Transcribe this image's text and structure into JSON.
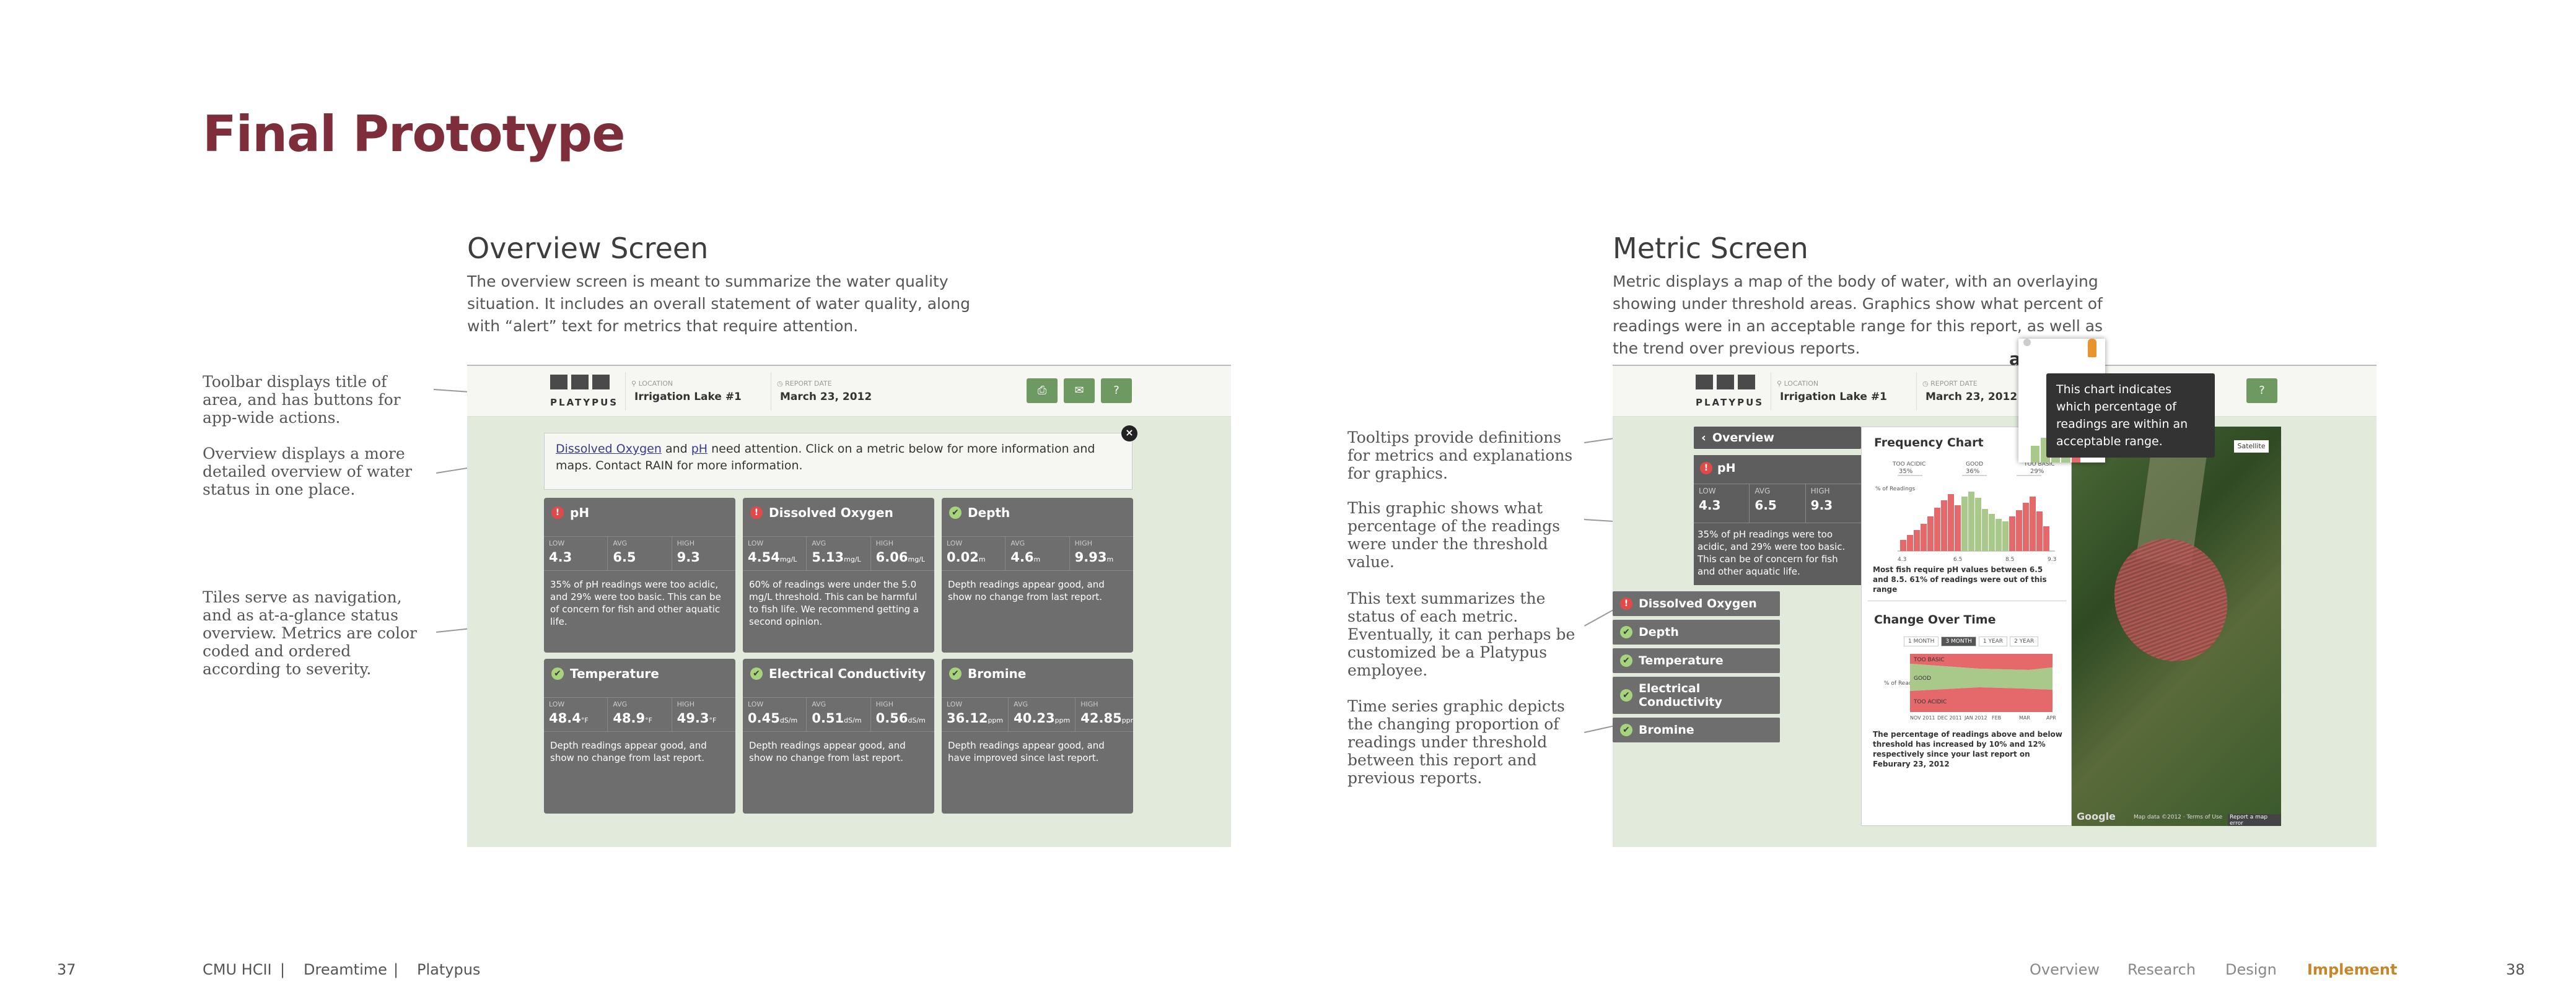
{
  "title": "Final Prototype",
  "overview": {
    "heading": "Overview Screen",
    "description": "The overview screen is meant to summarize the water quality situation. It includes an overall statement of water quality, along with “alert” text for metrics that require attention."
  },
  "metric": {
    "heading": "Metric Screen",
    "description": "Metric displays a map of the body of water, with an overlaying showing under threshold areas. Graphics show what percent of readings were in an acceptable range for this report, as well as the trend over previous reports."
  },
  "left_annotations": [
    "Toolbar displays title of area, and has buttons for app-wide actions.",
    "Overview displays a more detailed overview of water status in one place.",
    "Tiles serve as navigation, and as at-a-glance status overview. Metrics are color coded and ordered according to severity."
  ],
  "right_annotations": [
    "Tooltips provide definitions for metrics and explanations for graphics.",
    "This graphic shows what percentage of the readings were under the threshold value.",
    "This text summarizes the status of each metric. Eventually, it can perhaps be customized be a Platypus employee.",
    "Time series graphic depicts the changing proportion of readings under threshold between this report and previous reports."
  ],
  "toolbar": {
    "brand": "PLATYPUS",
    "location_label": "LOCATION",
    "location": "Irrigation Lake #1",
    "date_label": "REPORT DATE",
    "date": "March 23, 2012",
    "print_icon": "print-icon",
    "email_icon": "email-icon",
    "help_icon": "help-icon"
  },
  "alert": {
    "link1": "Dissolved Oxygen",
    "and": "and",
    "link2": "pH",
    "rest": "need attention. Click on a metric below for more information and maps. Contact RAIN for more information."
  },
  "stat_labels": {
    "low": "LOW",
    "avg": "AVG",
    "high": "HIGH"
  },
  "tiles": [
    {
      "name": "pH",
      "status": "bad",
      "icon": "!",
      "low": "4.3",
      "low_u": "",
      "avg": "6.5",
      "avg_u": "",
      "high": "9.3",
      "high_u": "",
      "desc": "35% of pH readings were too acidic, and 29% were too basic. This can be of concern for fish and other aquatic life."
    },
    {
      "name": "Dissolved Oxygen",
      "status": "bad",
      "icon": "!",
      "low": "4.54",
      "low_u": "mg/L",
      "avg": "5.13",
      "avg_u": "mg/L",
      "high": "6.06",
      "high_u": "mg/L",
      "desc": "60% of readings were under the 5.0 mg/L threshold. This can be harmful to fish life. We recommend getting a second opinion."
    },
    {
      "name": "Depth",
      "status": "ok",
      "icon": "✔",
      "low": "0.02",
      "low_u": "m",
      "avg": "4.6",
      "avg_u": "m",
      "high": "9.93",
      "high_u": "m",
      "desc": "Depth readings appear good, and show no change from last report."
    },
    {
      "name": "Temperature",
      "status": "ok",
      "icon": "✔",
      "low": "48.4",
      "low_u": "°F",
      "avg": "48.9",
      "avg_u": "°F",
      "high": "49.3",
      "high_u": "°F",
      "desc": "Depth readings appear good, and show no change from last report."
    },
    {
      "name": "Electrical Conductivity",
      "status": "ok",
      "icon": "✔",
      "low": "0.45",
      "low_u": "dS/m",
      "avg": "0.51",
      "avg_u": "dS/m",
      "high": "0.56",
      "high_u": "dS/m",
      "desc": "Depth readings appear good, and show no change from last report."
    },
    {
      "name": "Bromine",
      "status": "ok",
      "icon": "✔",
      "low": "36.12",
      "low_u": "ppm",
      "avg": "40.23",
      "avg_u": "ppm",
      "high": "42.85",
      "high_u": "ppm",
      "desc": "Depth readings appear good, and have improved since last report."
    }
  ],
  "metric_screen": {
    "back": "Overview",
    "ph_title": "pH",
    "ph_low": "4.3",
    "ph_avg": "6.5",
    "ph_high": "9.3",
    "ph_desc": "35% of pH readings were too acidic, and 29% were too basic. This can be of concern for fish and other aquatic life.",
    "others": [
      "Dissolved Oxygen",
      "Depth",
      "Temperature",
      "Electrical Conductivity",
      "Bromine"
    ],
    "freq_title": "Frequency Chart",
    "too_acidic": "TOO ACIDIC",
    "too_acidic_pct": "35%",
    "good": "GOOD",
    "good_pct": "36%",
    "too_basic": "TOO BASIC",
    "too_basic_pct": "29%",
    "y_label": "% of Readings",
    "x_ticks": [
      "4.3",
      "6.5",
      "8.5",
      "9.3"
    ],
    "freq_caption": "Most fish require pH values between 6.5 and 8.5. 61% of readings were out of this range",
    "change_title": "Change Over Time",
    "ranges": [
      "1 MONTH",
      "3 MONTH",
      "1 YEAR",
      "2 YEAR"
    ],
    "bands": [
      "TOO BASIC",
      "GOOD",
      "TOO ACIDIC"
    ],
    "months": [
      "NOV 2011",
      "DEC 2011",
      "JAN 2012",
      "FEB",
      "MAR",
      "APR"
    ],
    "change_caption": "The percentage of readings above and below threshold has increased by 10% and 12% respectively since your last report on Feburary 23, 2012",
    "tooltip": "This chart indicates which percentage of readings are within an acceptable range.",
    "tooltip_behind": "art",
    "google": "Google",
    "map_terms": "Map data ©2012 · Terms of Use",
    "report": "Report a map error",
    "satellite": "Satellite"
  },
  "footer": {
    "page_left": "37",
    "org": "CMU HCII",
    "sep": "|",
    "project": "Dreamtime",
    "client": "Platypus",
    "nav": [
      "Overview",
      "Research",
      "Design",
      "Implement"
    ],
    "page_right": "38"
  }
}
